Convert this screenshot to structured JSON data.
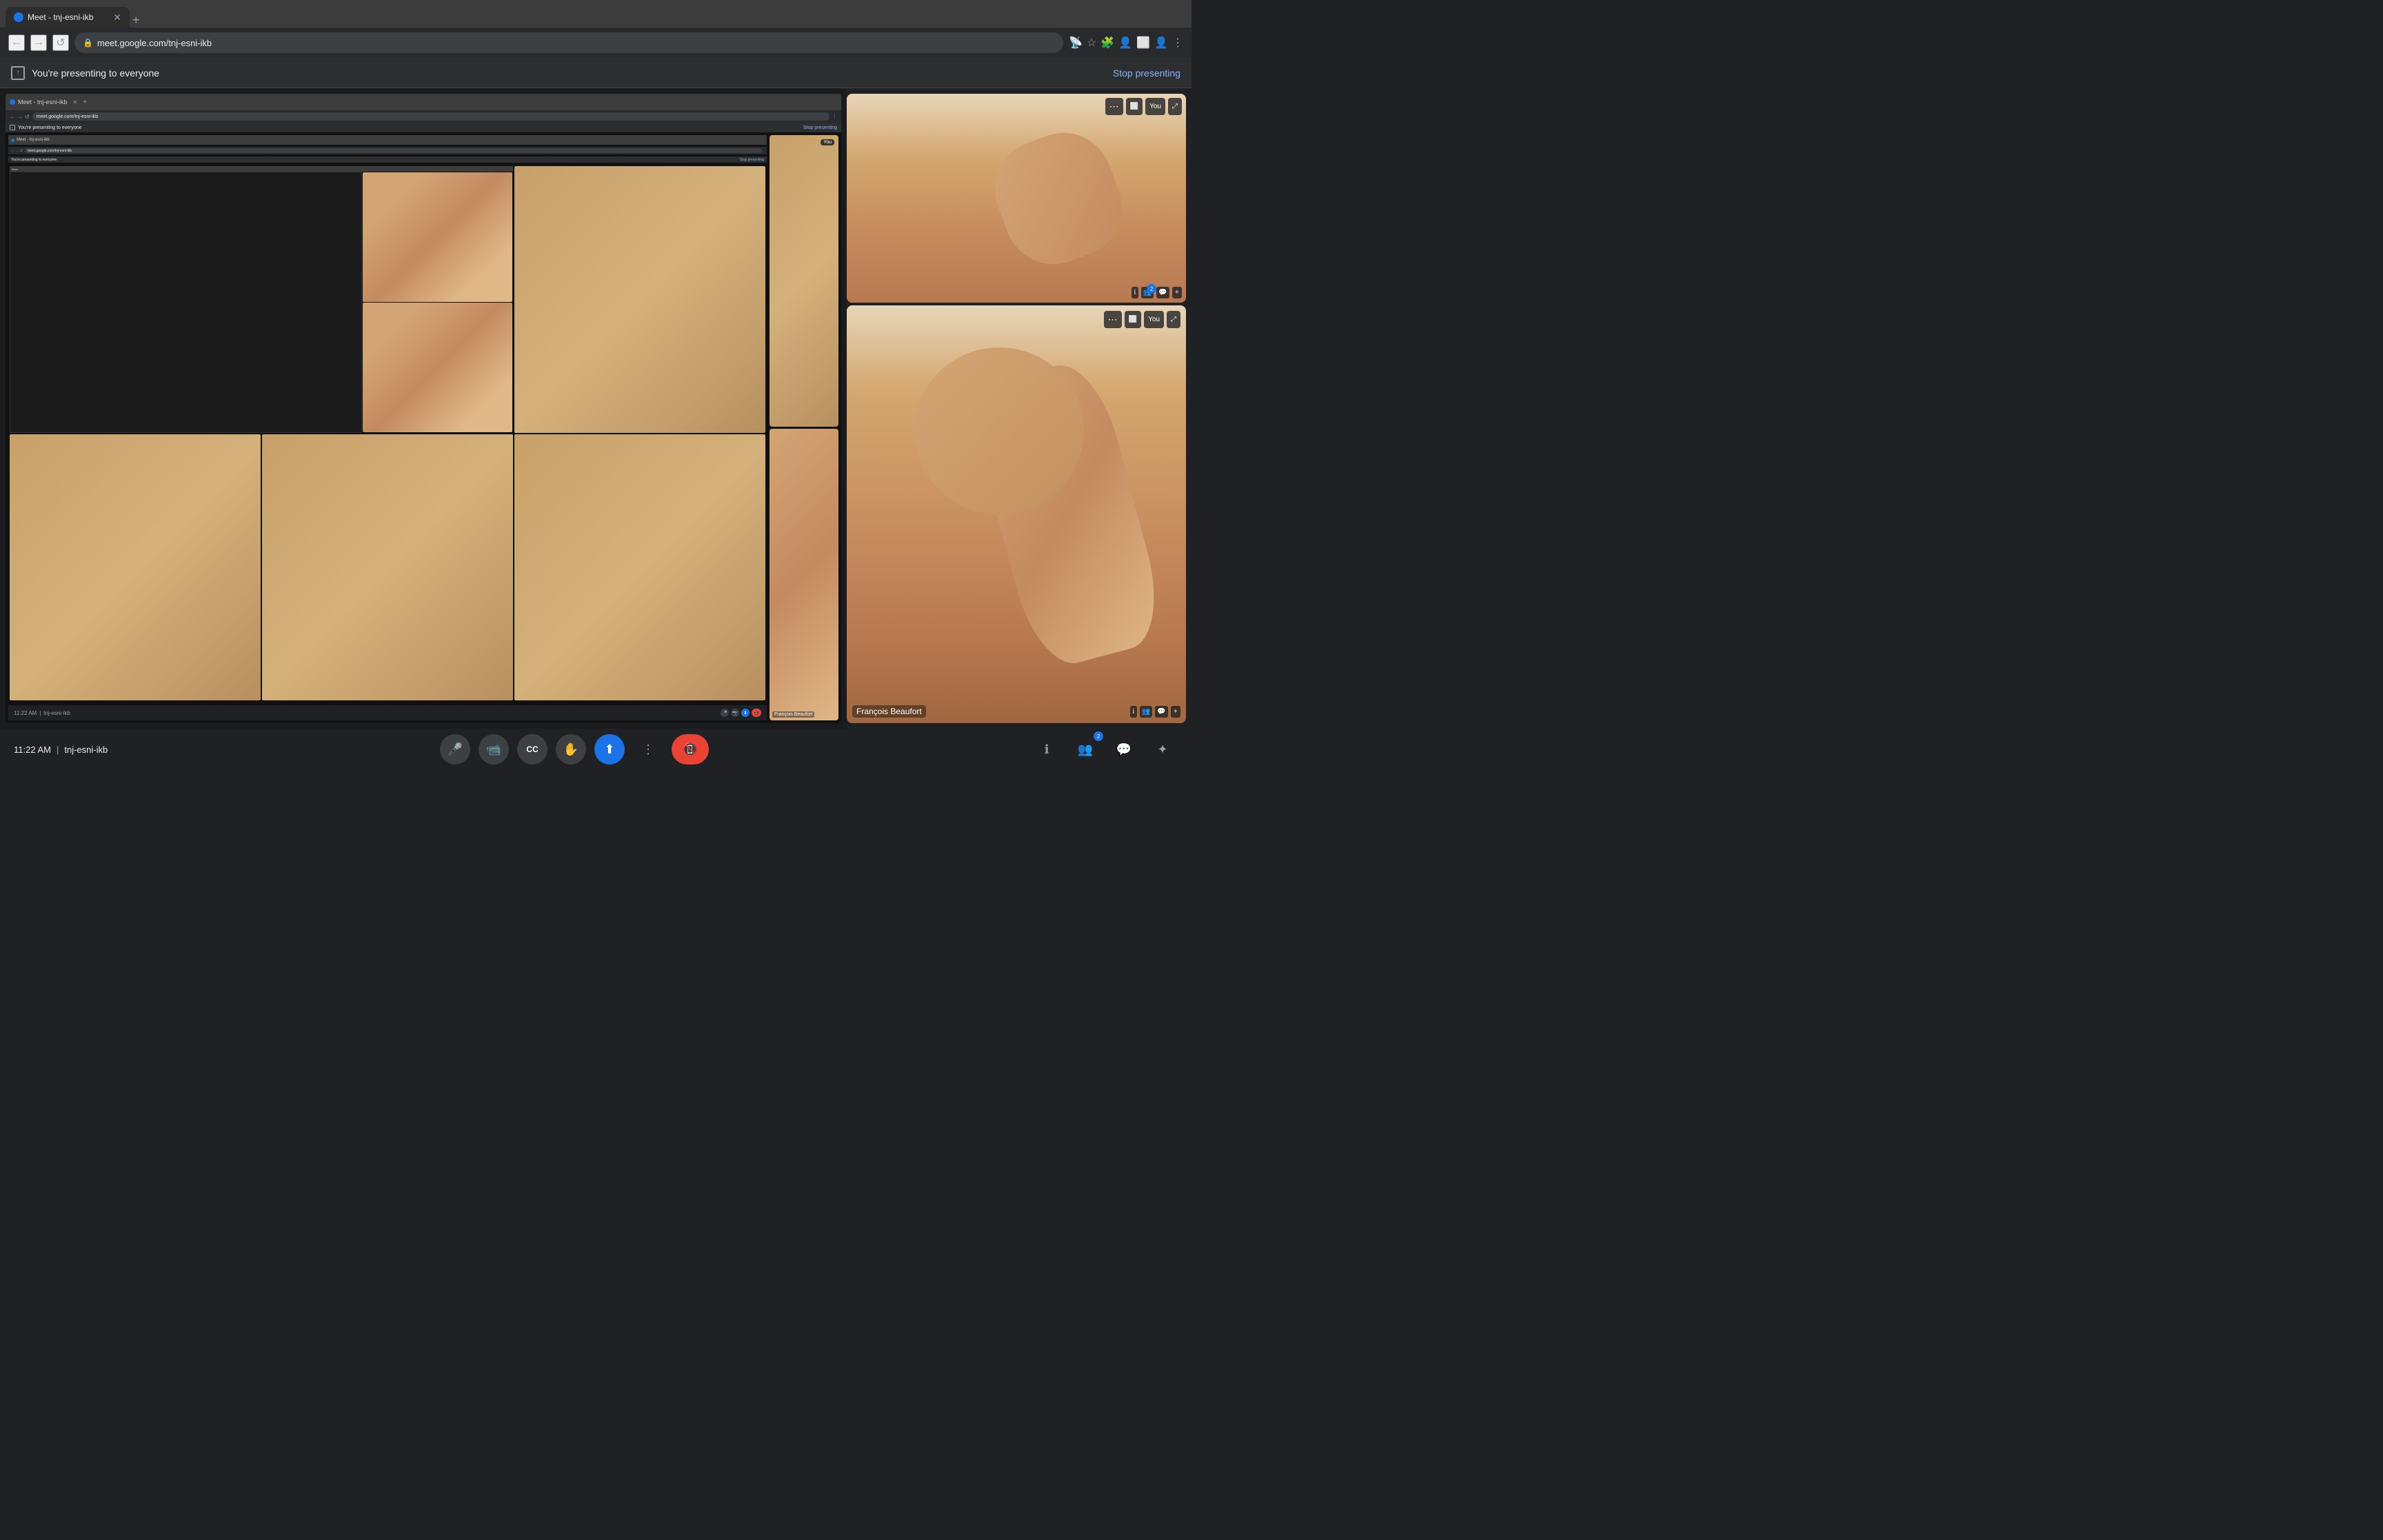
{
  "browser": {
    "tab_title": "Meet - tnj-esni-ikb",
    "new_tab_label": "+",
    "back_btn": "←",
    "forward_btn": "→",
    "reload_btn": "↺",
    "address": "meet.google.com/tnj-esni-ikb",
    "more_label": "⋮"
  },
  "presentation": {
    "banner_text": "You're presenting to everyone",
    "stop_btn": "Stop presenting"
  },
  "participants": {
    "francois": "François Beaufort",
    "you": "You"
  },
  "meeting": {
    "time": "11:22 AM",
    "separator": "|",
    "code": "tnj-esni-ikb"
  },
  "toolbar": {
    "mic_label": "🎤",
    "camera_label": "📷",
    "captions_label": "CC",
    "raise_hand_label": "✋",
    "present_label": "⬆",
    "more_label": "⋮",
    "end_call_label": "📵",
    "info_icon": "ℹ",
    "people_icon": "👥",
    "chat_icon": "💬",
    "activities_icon": "✦"
  },
  "nested": {
    "banner_text": "You're presenting to everyone",
    "stop_btn": "Stop presenting",
    "address": "meet.google.com/tnj-esni-ikb",
    "time": "11:22 AM",
    "code": "tnj-esni-ikb"
  },
  "deep_nested": {
    "banner_text": "You're presenting to everyone",
    "stop_btn": "Stop presenting"
  }
}
